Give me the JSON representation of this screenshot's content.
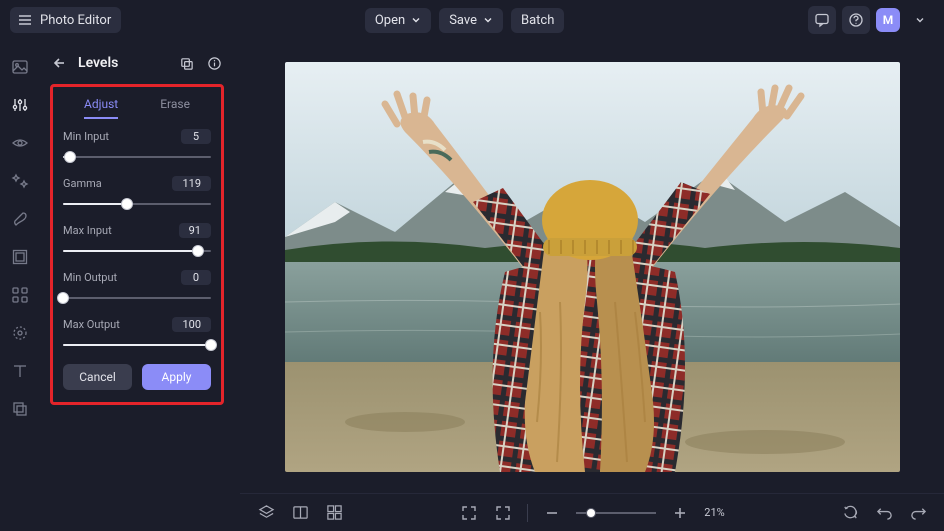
{
  "app": {
    "title": "Photo Editor"
  },
  "topbar": {
    "open": "Open",
    "save": "Save",
    "batch": "Batch",
    "avatar": "M"
  },
  "panel": {
    "title": "Levels",
    "tabs": {
      "adjust": "Adjust",
      "erase": "Erase"
    },
    "controls": {
      "min_input": {
        "label": "Min Input",
        "value": "5",
        "pct": 5
      },
      "gamma": {
        "label": "Gamma",
        "value": "119",
        "pct": 43
      },
      "max_input": {
        "label": "Max Input",
        "value": "91",
        "pct": 91
      },
      "min_output": {
        "label": "Min Output",
        "value": "0",
        "pct": 0
      },
      "max_output": {
        "label": "Max Output",
        "value": "100",
        "pct": 100
      }
    },
    "buttons": {
      "cancel": "Cancel",
      "apply": "Apply"
    }
  },
  "canvas": {
    "zoom_pct": "21%"
  },
  "colors": {
    "sky_top": "#e3edf2",
    "sky_bottom": "#c6d8df",
    "mountain": "#6f7f7e",
    "forest": "#2e4a2d",
    "water": "#6e8786",
    "ground": "#a59774",
    "beanie": "#d6a63a",
    "shirt_red": "#9a2e2a",
    "shirt_dark": "#2a2a30",
    "hair": "#c9a060",
    "skin": "#d9b692"
  }
}
